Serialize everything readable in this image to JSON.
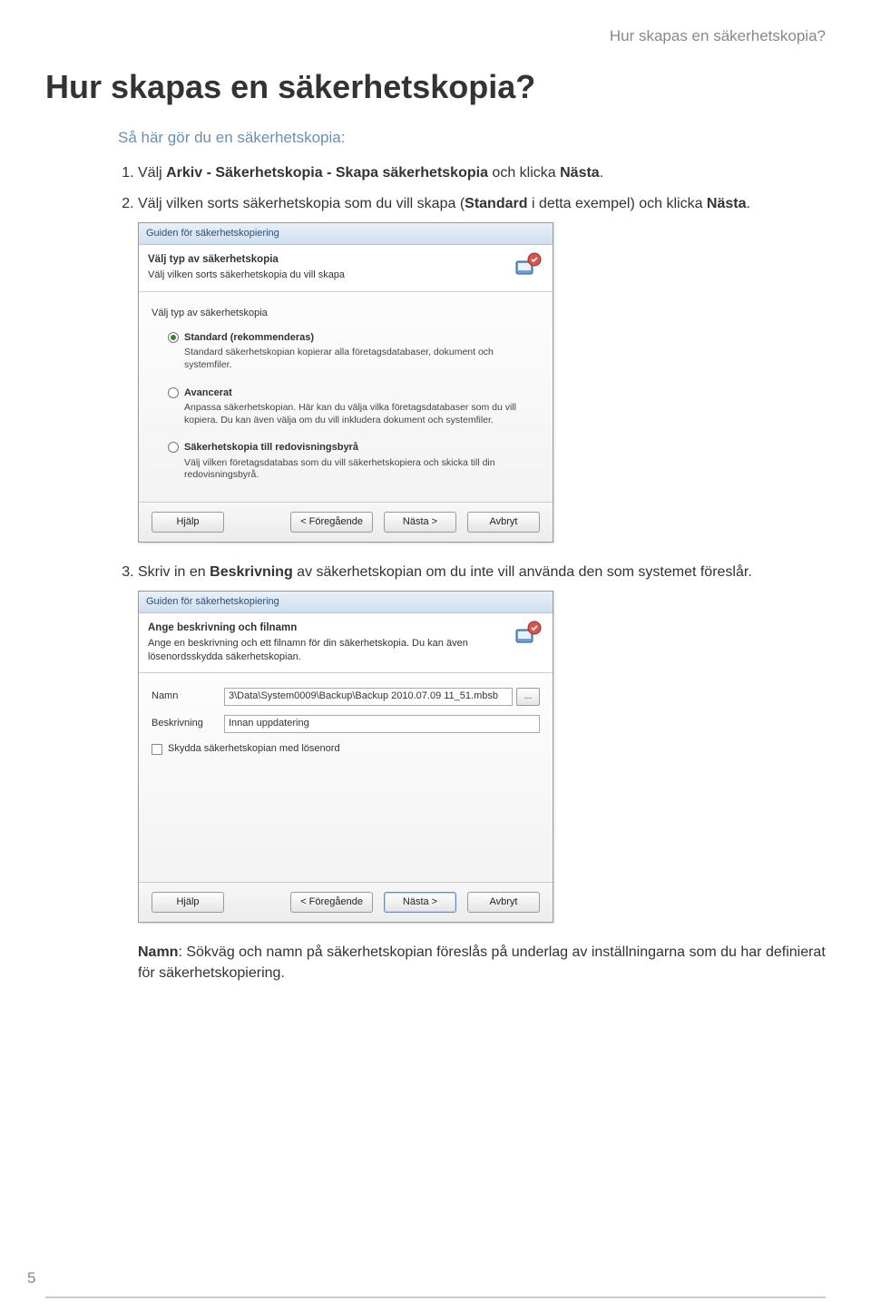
{
  "header": {
    "running_head": "Hur skapas en säkerhetskopia?"
  },
  "title": "Hur skapas en säkerhetskopia?",
  "intro": "Så här gör du en säkerhetskopia:",
  "steps": {
    "s1_pre": "Välj ",
    "s1_b1": "Arkiv - Säkerhetskopia - Skapa säkerhetskopia",
    "s1_mid": " och klicka ",
    "s1_b2": "Nästa",
    "s1_end": ".",
    "s2_pre": "Välj vilken sorts säkerhetskopia som du vill skapa (",
    "s2_b1": "Standard",
    "s2_mid": " i detta exempel) och klicka ",
    "s2_b2": "Nästa",
    "s2_end": ".",
    "s3_pre": "Skriv in en ",
    "s3_b1": "Beskrivning",
    "s3_post": " av säkerhetskopian om du inte vill använda den som systemet föreslår."
  },
  "dialog1": {
    "title": "Guiden för säkerhetskopiering",
    "header_h1": "Välj typ av säkerhetskopia",
    "header_h2": "Välj vilken sorts säkerhetskopia du vill skapa",
    "section_label": "Välj typ av säkerhetskopia",
    "options": [
      {
        "label": "Standard (rekommenderas)",
        "desc": "Standard säkerhetskopian kopierar alla företagsdatabaser, dokument och systemfiler.",
        "checked": true
      },
      {
        "label": "Avancerat",
        "desc": "Anpassa säkerhetskopian. Här kan du välja vilka företagsdatabaser som du vill kopiera. Du kan även välja om du vill inkludera dokument och systemfiler.",
        "checked": false
      },
      {
        "label": "Säkerhetskopia till redovisningsbyrå",
        "desc": "Välj vilken företagsdatabas som du vill säkerhetskopiera och skicka till din redovisningsbyrå.",
        "checked": false
      }
    ],
    "buttons": {
      "help": "Hjälp",
      "prev": "< Föregående",
      "next": "Nästa >",
      "cancel": "Avbryt"
    }
  },
  "dialog2": {
    "title": "Guiden för säkerhetskopiering",
    "header_h1": "Ange beskrivning och filnamn",
    "header_h2": "Ange en beskrivning och ett filnamn för din säkerhetskopia. Du kan även lösenordsskydda säkerhetskopian.",
    "name_label": "Namn",
    "name_value": "3\\Data\\System0009\\Backup\\Backup 2010.07.09 11_51.mbsb",
    "browse": "...",
    "desc_label": "Beskrivning",
    "desc_value": "Innan uppdatering",
    "protect_label": "Skydda säkerhetskopian med lösenord",
    "buttons": {
      "help": "Hjälp",
      "prev": "< Föregående",
      "next": "Nästa >",
      "cancel": "Avbryt"
    }
  },
  "footnote": {
    "label": "Namn",
    "text": ": Sökväg och namn på säkerhetskopian föreslås på underlag av inställningarna som du har definierat för säkerhetskopiering."
  },
  "page_number": "5"
}
